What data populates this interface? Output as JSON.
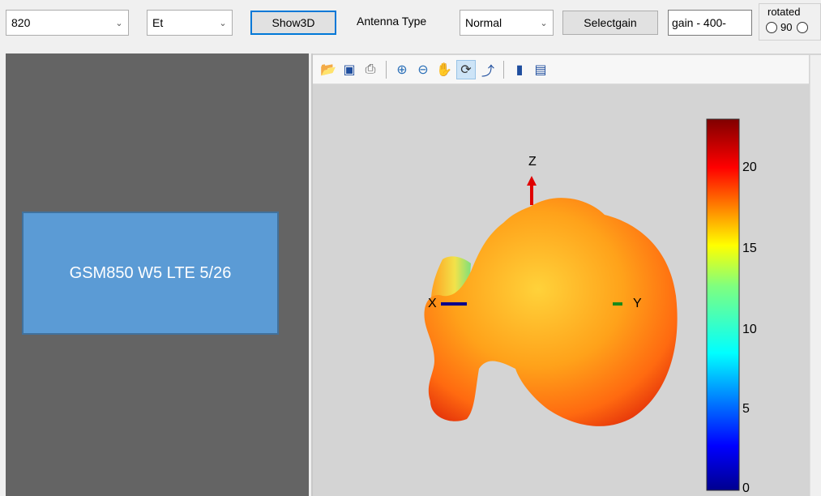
{
  "toolbar": {
    "frequency": {
      "value": "820"
    },
    "component": {
      "value": "Et"
    },
    "show3d_label": "Show3D",
    "antenna_type_label": "Antenna Type",
    "antenna_type": {
      "value": "Normal"
    },
    "selectgain_label": "Selectgain",
    "gain_field": {
      "value": "gain - 400-"
    },
    "rotated": {
      "label": "rotated",
      "option_90": "90"
    }
  },
  "band_box": {
    "text": "GSM850 W5 LTE 5/26"
  },
  "figure": {
    "axes": {
      "x": "X",
      "y": "Y",
      "z": "Z"
    },
    "colorbar_ticks": [
      "20",
      "15",
      "10",
      "5",
      "0"
    ],
    "toolbar_icons": [
      "open-file-icon",
      "save-icon",
      "print-icon",
      "zoom-in-icon",
      "zoom-out-icon",
      "pan-hand-icon",
      "rotate-3d-icon",
      "data-cursor-icon",
      "colorbar-icon",
      "legend-icon"
    ]
  },
  "colors": {
    "left_panel": "#646464",
    "box_fill": "#5b9bd5",
    "figure_bg": "#d4d4d4"
  }
}
